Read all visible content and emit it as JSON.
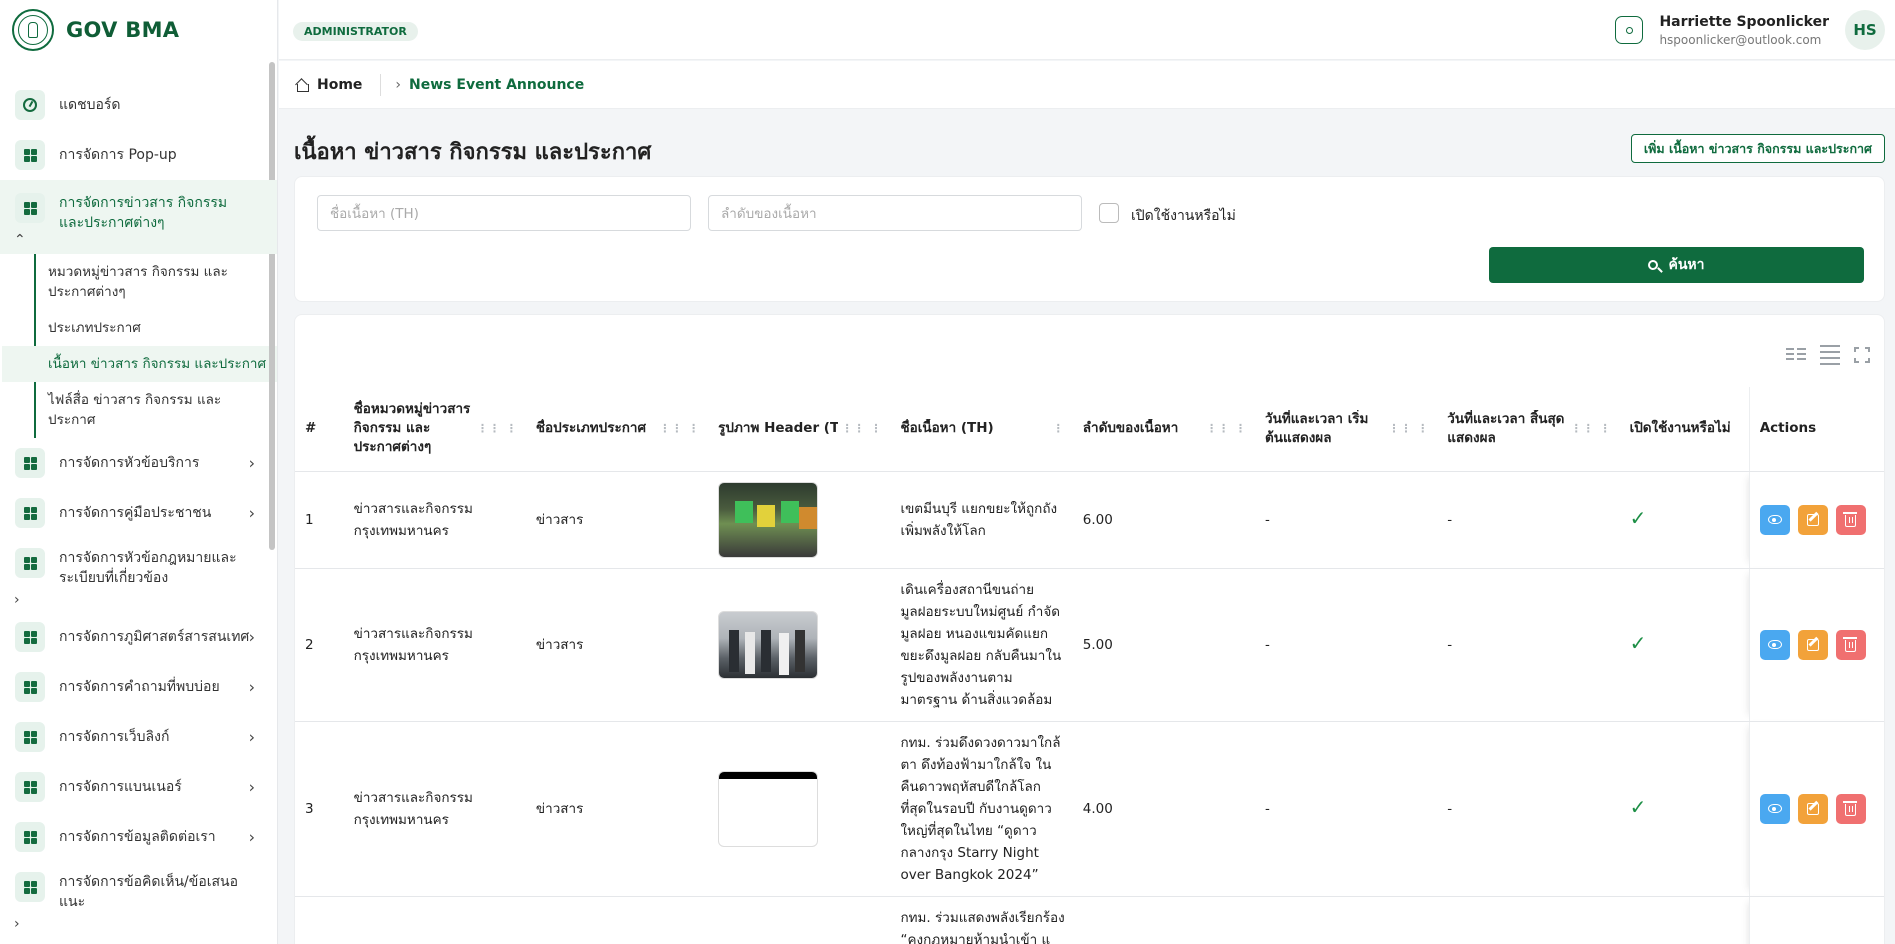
{
  "app": {
    "title": "GOV BMA"
  },
  "header": {
    "role": "ADMINISTRATOR",
    "user_name": "Harriette Spoonlicker",
    "user_email": "hspoonlicker@outlook.com",
    "avatar_initials": "HS"
  },
  "sidebar": {
    "items": [
      {
        "label": "แดชบอร์ด",
        "icon": "dashboard-icon"
      },
      {
        "label": "การจัดการ Pop-up",
        "icon": "grid-icon"
      },
      {
        "label": "การจัดการข่าวสาร กิจกรรม และประกาศต่างๆ",
        "icon": "grid-icon",
        "expanded": true
      },
      {
        "label": "การจัดการหัวข้อบริการ",
        "icon": "grid-icon"
      },
      {
        "label": "การจัดการคู่มือประชาชน",
        "icon": "grid-icon"
      },
      {
        "label": "การจัดการหัวข้อกฎหมายและระเบียบที่เกี่ยวข้อง",
        "icon": "grid-icon"
      },
      {
        "label": "การจัดการภูมิศาสตร์สารสนเทศ",
        "icon": "grid-icon"
      },
      {
        "label": "การจัดการคำถามที่พบบ่อย",
        "icon": "grid-icon"
      },
      {
        "label": "การจัดการเว็บลิงก์",
        "icon": "grid-icon"
      },
      {
        "label": "การจัดการแบนเนอร์",
        "icon": "grid-icon"
      },
      {
        "label": "การจัดการข้อมูลติดต่อเรา",
        "icon": "grid-icon"
      },
      {
        "label": "การจัดการข้อคิดเห็น/ข้อเสนอแนะ",
        "icon": "grid-icon"
      }
    ],
    "submenu": [
      {
        "label": "หมวดหมู่ข่าวสาร กิจกรรม และประกาศต่างๆ"
      },
      {
        "label": "ประเภทประกาศ"
      },
      {
        "label": "เนื้อหา ข่าวสาร กิจกรรม และประกาศ",
        "active": true
      },
      {
        "label": "ไฟล์สื่อ ข่าวสาร กิจกรรม และประกาศ"
      }
    ]
  },
  "breadcrumb": {
    "home": "Home",
    "current": "News Event Announce"
  },
  "page": {
    "title": "เนื้อหา ข่าวสาร กิจกรรม และประกาศ",
    "add_button": "เพิ่ม เนื้อหา ข่าวสาร กิจกรรม และประกาศ"
  },
  "filters": {
    "name_placeholder": "ชื่อเนื้อหา (TH)",
    "order_placeholder": "ลำดับของเนื้อหา",
    "active_label": "เปิดใช้งานหรือไม่",
    "search_button": "ค้นหา"
  },
  "table": {
    "headers": {
      "index": "#",
      "category": "ชื่อหมวดหมู่ข่าวสาร กิจกรรม และประกาศต่างๆ",
      "type": "ชื่อประเภทประกาศ",
      "image": "รูปภาพ Header (TH)",
      "name": "ชื่อเนื้อหา (TH)",
      "order": "ลำดับของเนื้อหา",
      "start": "วันที่และเวลา เริ่มต้นแสดงผล",
      "end": "วันที่และเวลา สิ้นสุดแสดงผล",
      "active": "เปิดใช้งานหรือไม่",
      "actions": "Actions"
    },
    "rows": [
      {
        "index": "1",
        "category": "ข่าวสารและกิจกรรมกรุงเทพมหานคร",
        "type": "ข่าวสาร",
        "name": "เขตมีนบุรี แยกขยะให้ถูกถังเพิ่มพลังให้โลก",
        "order": "6.00",
        "start": "-",
        "end": "-",
        "active": "✓"
      },
      {
        "index": "2",
        "category": "ข่าวสารและกิจกรรมกรุงเทพมหานคร",
        "type": "ข่าวสาร",
        "name": "เดินเครื่องสถานีขนถ่ายมูลฝอยระบบใหม่ศูนย์ กำจัดมูลฝอย หนองแขมคัดแยกขยะดึงมูลฝอย กลับคืนมาในรูปของพลังงานตามมาตรฐาน ด้านสิ่งแวดล้อม",
        "order": "5.00",
        "start": "-",
        "end": "-",
        "active": "✓"
      },
      {
        "index": "3",
        "category": "ข่าวสารและกิจกรรมกรุงเทพมหานคร",
        "type": "ข่าวสาร",
        "name": "กทม. ร่วมดึงดวงดาวมาใกล้ตา ดึงท้องฟ้ามาใกล้ใจ ในคืนดาวพฤหัสบดีใกล้โลกที่สุดในรอบปี กับงานดูดาวใหญ่ที่สุดในไทย “ดูดาวกลางกรุง Starry Night over Bangkok 2024”",
        "order": "4.00",
        "start": "-",
        "end": "-",
        "active": "✓"
      },
      {
        "index": "",
        "category": "",
        "type": "",
        "name": "กทม. ร่วมแสดงพลังเรียกร้อง “คงกฎหมายห้ามนำเข้า แ",
        "order": "",
        "start": "",
        "end": "",
        "active": ""
      }
    ]
  }
}
